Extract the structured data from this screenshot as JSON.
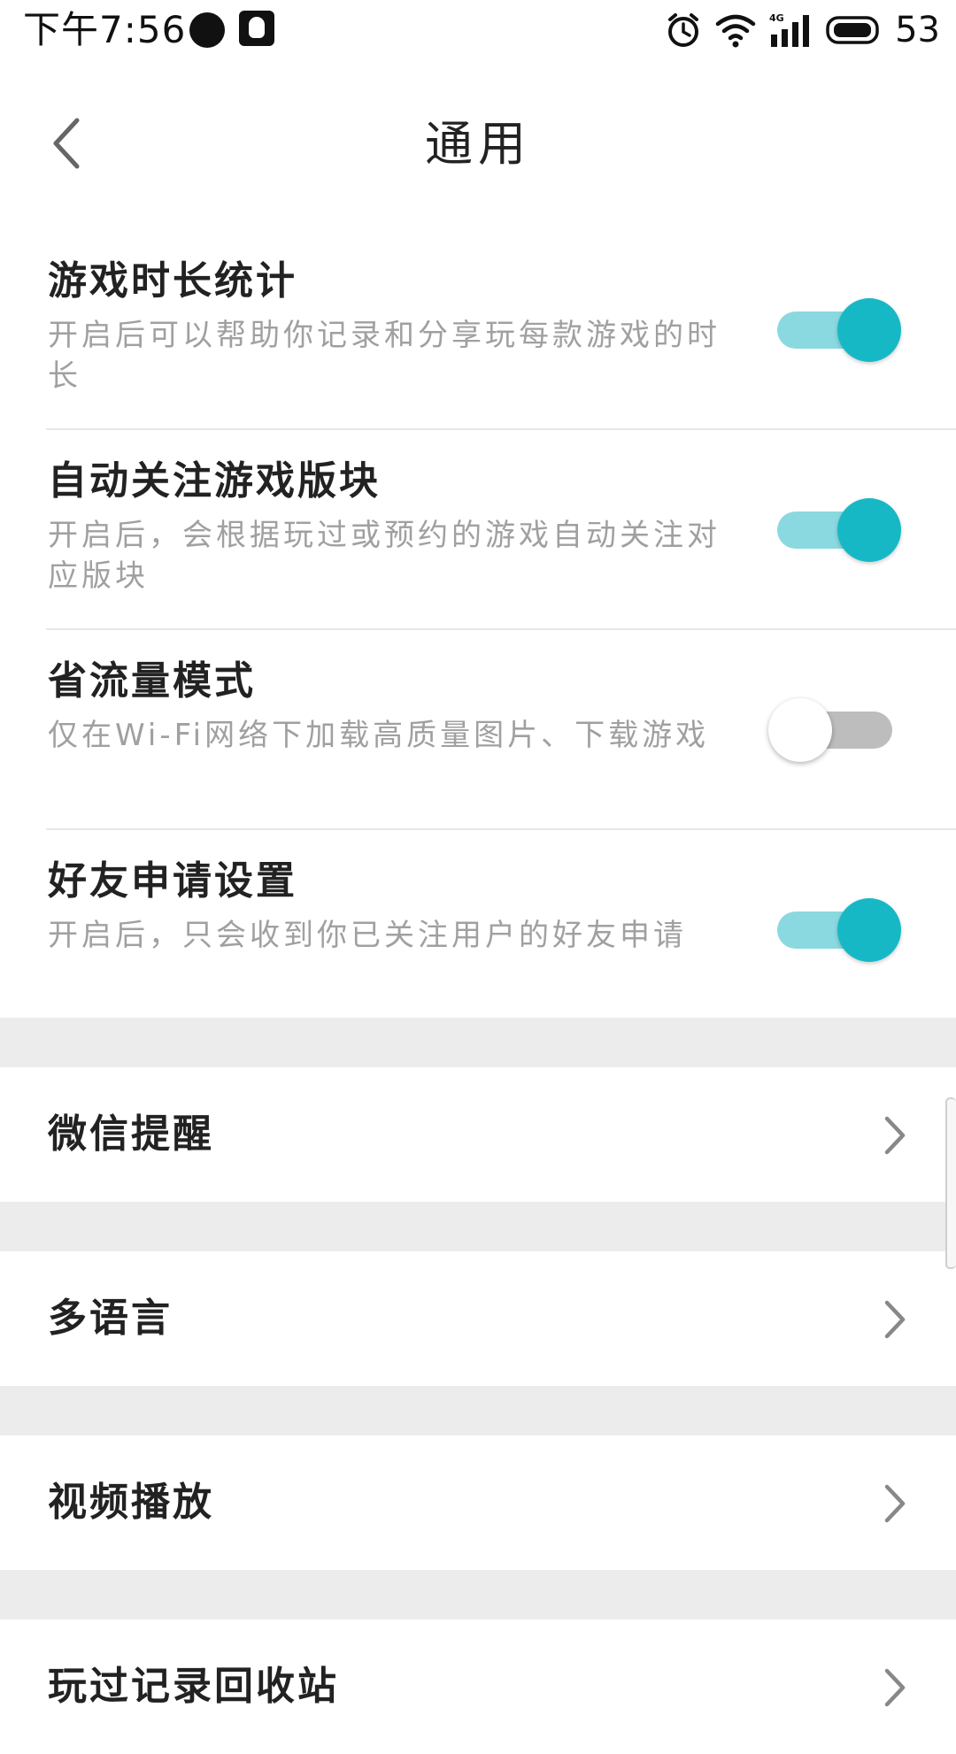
{
  "status_bar": {
    "time": "下午7:56",
    "battery": "53",
    "icons": [
      "notification-dot-icon",
      "qq-icon",
      "alarm-icon",
      "wifi-icon",
      "4g-signal-icon",
      "battery-icon"
    ]
  },
  "header": {
    "title": "通用",
    "back_icon": "back-arrow-icon"
  },
  "toggles": [
    {
      "title": "游戏时长统计",
      "description": "开启后可以帮助你记录和分享玩每款游戏的时长",
      "enabled": true
    },
    {
      "title": "自动关注游戏版块",
      "description": "开启后，会根据玩过或预约的游戏自动关注对应版块",
      "enabled": true
    },
    {
      "title": "省流量模式",
      "description": "仅在Wi-Fi网络下加载高质量图片、下载游戏",
      "enabled": false
    },
    {
      "title": "好友申请设置",
      "description": "开启后，只会收到你已关注用户的好友申请",
      "enabled": true
    }
  ],
  "nav_items": [
    {
      "label": "微信提醒"
    },
    {
      "label": "多语言"
    },
    {
      "label": "视频播放"
    },
    {
      "label": "玩过记录回收站"
    }
  ],
  "colors": {
    "accent": "#17b8c6",
    "accent_track": "#8ad8e0",
    "off_track": "#bdbdbd",
    "separator_gap": "#ececec",
    "desc_text": "#a0a0a0"
  }
}
